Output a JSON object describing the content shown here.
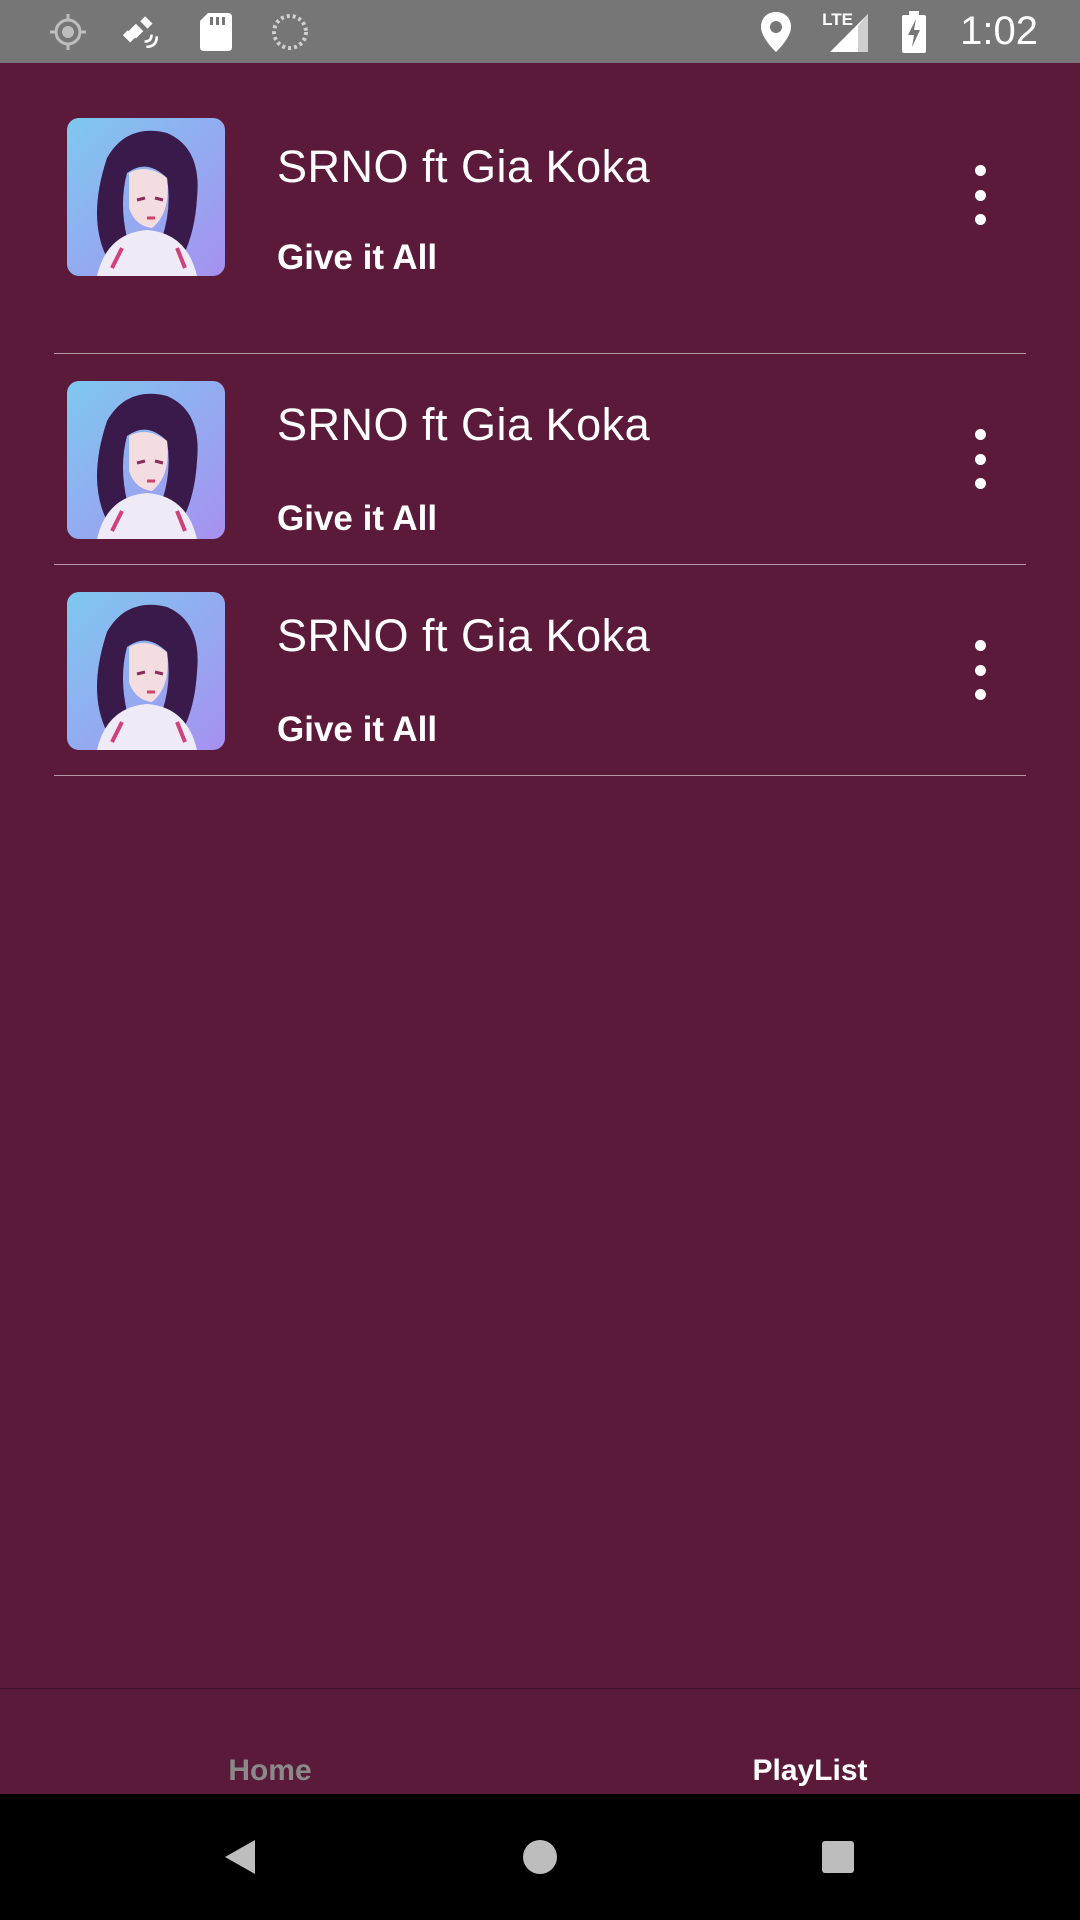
{
  "status_bar": {
    "time": "1:02",
    "network": "LTE",
    "left_icons": [
      "gps-icon",
      "satellite-fax-icon",
      "sd-card-icon",
      "loading-icon"
    ],
    "right_icons": [
      "location-icon",
      "signal-icon",
      "battery-charging-icon"
    ]
  },
  "tracks": [
    {
      "artist": "SRNO ft Gia Koka",
      "title": "Give it All"
    },
    {
      "artist": "SRNO ft Gia Koka",
      "title": "Give it All"
    },
    {
      "artist": "SRNO ft Gia Koka",
      "title": "Give it All"
    }
  ],
  "tabs": {
    "home": "Home",
    "playlist": "PlayList",
    "active": "playlist"
  },
  "colors": {
    "background": "#5c1a3a",
    "status_bar": "#767676",
    "nav_bar": "#000000",
    "tab_inactive": "#8a8a8a",
    "tab_active": "#ffffff"
  }
}
